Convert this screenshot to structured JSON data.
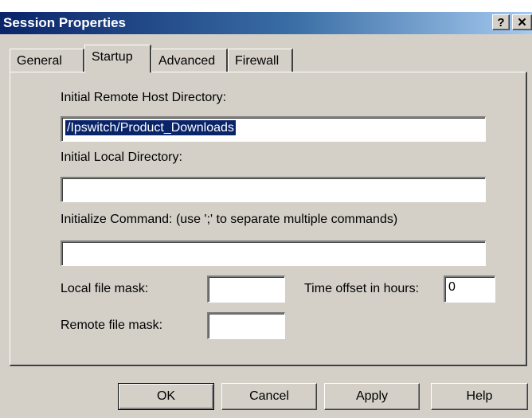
{
  "window": {
    "title": "Session Properties",
    "help_glyph": "?",
    "close_glyph": "✕"
  },
  "tabs": [
    {
      "label": "General",
      "active": false
    },
    {
      "label": "Startup",
      "active": true
    },
    {
      "label": "Advanced",
      "active": false
    },
    {
      "label": "Firewall",
      "active": false
    }
  ],
  "startup": {
    "remote_dir_label": "Initial Remote Host Directory:",
    "remote_dir_value": "/Ipswitch/Product_Downloads",
    "local_dir_label": "Initial Local Directory:",
    "local_dir_value": "",
    "init_cmd_label": "Initialize Command: (use ';' to separate multiple commands)",
    "init_cmd_value": "",
    "local_mask_label": "Local file mask:",
    "local_mask_value": "",
    "remote_mask_label": "Remote file mask:",
    "remote_mask_value": "",
    "time_offset_label": "Time offset in hours:",
    "time_offset_value": "0"
  },
  "buttons": {
    "ok": "OK",
    "cancel": "Cancel",
    "apply": "Apply",
    "help": "Help"
  },
  "colors": {
    "titlebar_start": "#0a246a",
    "titlebar_end": "#a6caf0",
    "face": "#d4d0c8",
    "selection": "#0a246a"
  }
}
